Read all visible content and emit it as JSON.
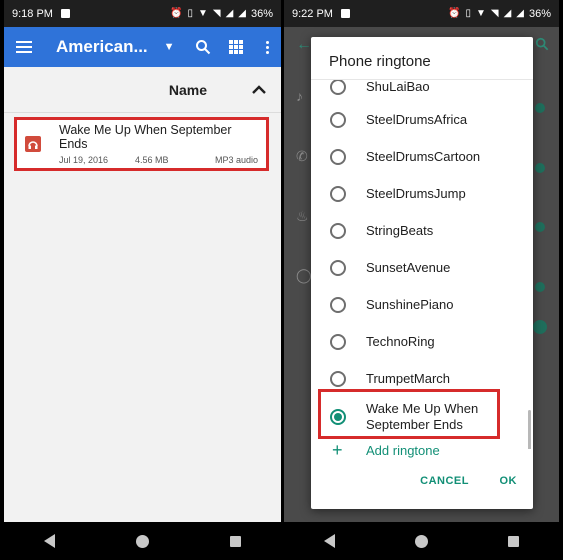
{
  "left_phone": {
    "status": {
      "time": "9:18 PM",
      "battery": "36%"
    },
    "appbar": {
      "title": "American..."
    },
    "sort": {
      "label": "Name"
    },
    "file": {
      "name": "Wake Me Up When September Ends",
      "date": "Jul 19, 2016",
      "size": "4.56 MB",
      "type": "MP3 audio"
    }
  },
  "right_phone": {
    "status": {
      "time": "9:22 PM",
      "battery": "36%"
    },
    "dialog": {
      "title": "Phone ringtone",
      "items": [
        {
          "label": "ShuLaiBao",
          "selected": false
        },
        {
          "label": "SteelDrumsAfrica",
          "selected": false
        },
        {
          "label": "SteelDrumsCartoon",
          "selected": false
        },
        {
          "label": "SteelDrumsJump",
          "selected": false
        },
        {
          "label": "StringBeats",
          "selected": false
        },
        {
          "label": "SunsetAvenue",
          "selected": false
        },
        {
          "label": "SunshinePiano",
          "selected": false
        },
        {
          "label": "TechnoRing",
          "selected": false
        },
        {
          "label": "TrumpetMarch",
          "selected": false
        },
        {
          "label_line1": "Wake Me Up When",
          "label_line2": "September Ends",
          "selected": true
        }
      ],
      "add_label": "Add ringtone",
      "cancel_label": "CANCEL",
      "ok_label": "OK"
    }
  },
  "colors": {
    "accent": "#128f76",
    "appbar": "#2f73d9",
    "highlight": "#d62b2b"
  }
}
